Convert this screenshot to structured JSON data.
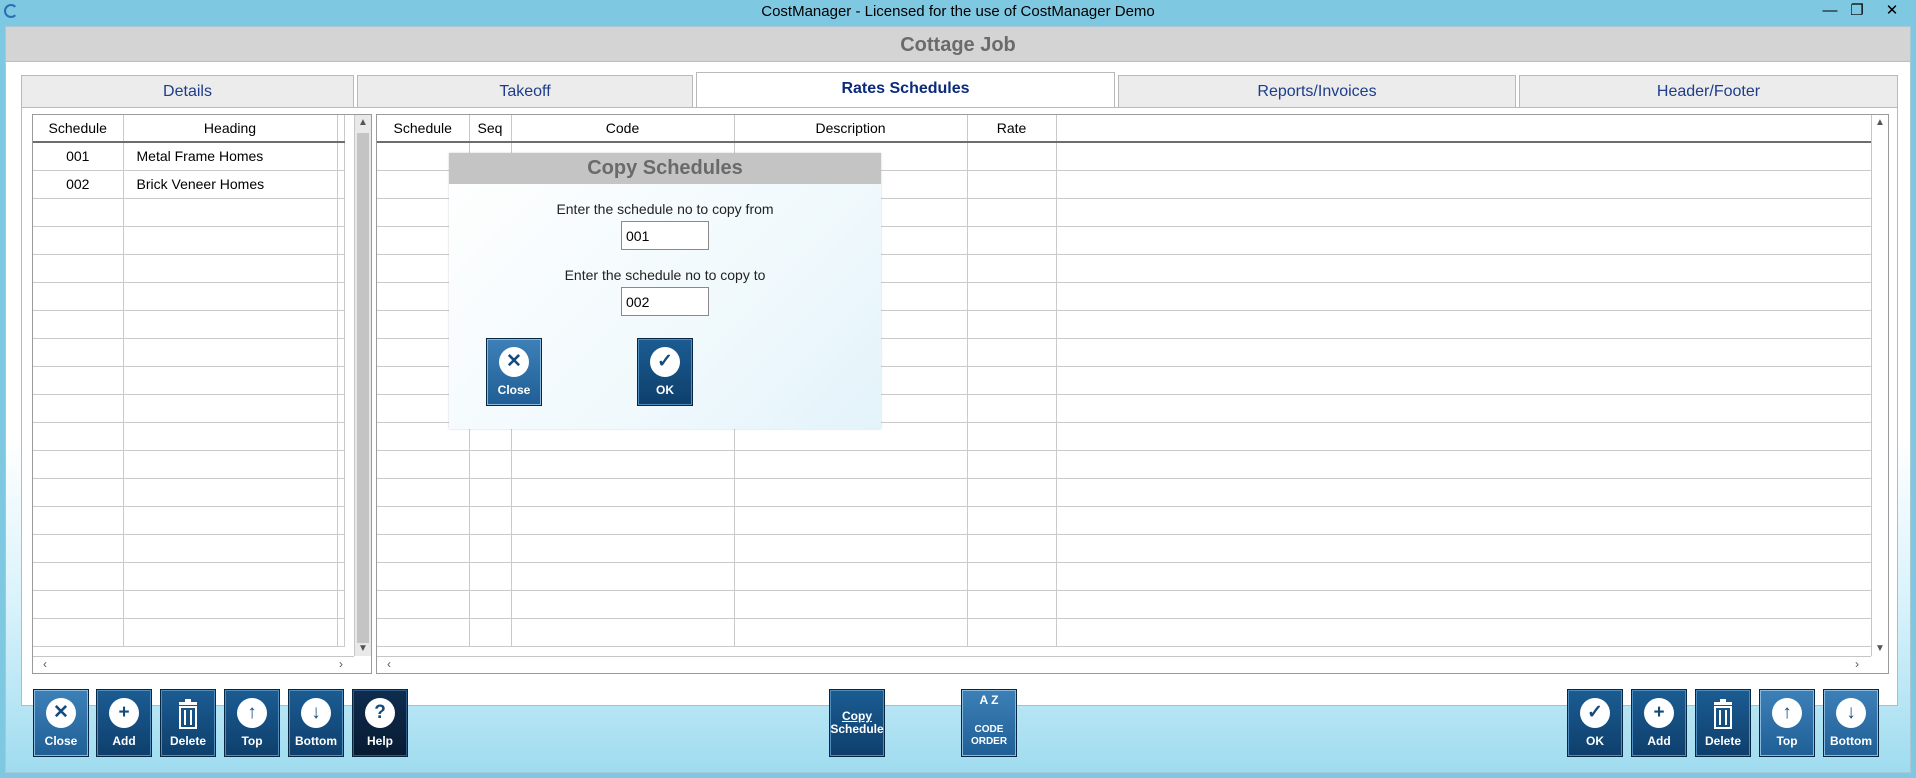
{
  "window": {
    "title": "CostManager - Licensed for the use of CostManager Demo",
    "minimize": "—",
    "restore": "❐",
    "close": "✕"
  },
  "job": {
    "title": "Cottage Job"
  },
  "tabs": [
    {
      "label": "Details"
    },
    {
      "label": "Takeoff"
    },
    {
      "label": "Rates Schedules",
      "active": true
    },
    {
      "label": "Reports/Invoices"
    },
    {
      "label": "Header/Footer"
    }
  ],
  "schedules": {
    "headers": [
      "Schedule",
      "Heading"
    ],
    "rows": [
      {
        "schedule": "001",
        "heading": "Metal Frame Homes"
      },
      {
        "schedule": "002",
        "heading": "Brick Veneer Homes"
      }
    ]
  },
  "rates": {
    "headers": [
      "Schedule",
      "Seq",
      "Code",
      "Description",
      "Rate"
    ]
  },
  "dialog": {
    "title": "Copy Schedules",
    "from_label": "Enter the schedule no to copy from",
    "from_value": "001",
    "to_label": "Enter the schedule no to copy to",
    "to_value": "002",
    "close_label": "Close",
    "ok_label": "OK"
  },
  "left_buttons": {
    "close": "Close",
    "add": "Add",
    "delete": "Delete",
    "top": "Top",
    "bottom": "Bottom",
    "help": "Help"
  },
  "center_buttons": {
    "copy_line1": "Copy",
    "copy_line2": "Schedule",
    "code_order_line1": "CODE",
    "code_order_line2": "ORDER",
    "code_order_glyph": "A Z"
  },
  "right_buttons": {
    "ok": "OK",
    "add": "Add",
    "delete": "Delete",
    "top": "Top",
    "bottom": "Bottom"
  }
}
